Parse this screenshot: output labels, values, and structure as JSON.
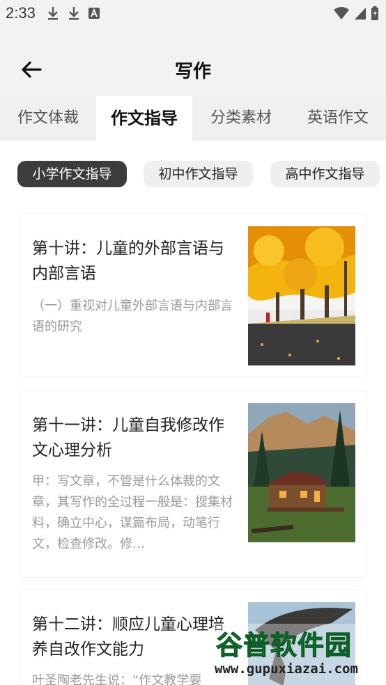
{
  "status_bar": {
    "time": "2:33"
  },
  "header": {
    "title": "写作"
  },
  "tabs": [
    {
      "label": "作文体裁"
    },
    {
      "label": "作文指导"
    },
    {
      "label": "分类素材"
    },
    {
      "label": "英语作文"
    }
  ],
  "chips": [
    {
      "label": "小学作文指导"
    },
    {
      "label": "初中作文指导"
    },
    {
      "label": "高中作文指导"
    }
  ],
  "articles": [
    {
      "title": "第十讲：儿童的外部言语与内部言语",
      "summary": "（一）重视对儿童外部言语与内部言语的研究"
    },
    {
      "title": "第十一讲：儿童自我修改作文心理分析",
      "summary": "甲：写文章，不管是什么体裁的文章，其写作的全过程一般是：搜集材料，确立中心，谋篇布局，动笔行文，检查修改。修…"
    },
    {
      "title": "第十二讲：顺应儿童心理培养自改作文能力",
      "summary": "叶圣陶老先生说：“作文教学要"
    }
  ],
  "watermark": {
    "brand": "谷普软件园",
    "url": "www.gupuxiazai.com"
  },
  "colors": {
    "active_tab_bg": "#ffffff",
    "active_chip_bg": "#3c3c3c",
    "header_bg": "#f2f2f2"
  }
}
